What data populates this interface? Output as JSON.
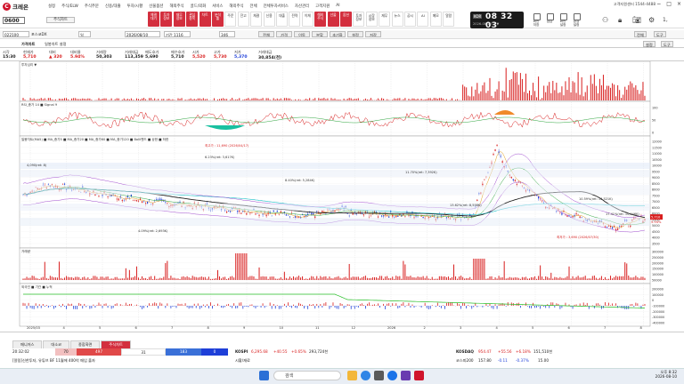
{
  "app": {
    "brand": "크레온",
    "brand_mark": "C"
  },
  "top_menu": [
    "설정",
    "주식/ELW",
    "주식주문",
    "신용/대출",
    "투자/시황",
    "선물옵션",
    "해외주식",
    "골드/외화",
    "서비스",
    "해외주식",
    "전체",
    "전체투자서비스",
    "자산관리",
    "고객지원",
    "AI"
  ],
  "help_line": "고객지원센터 1544-4488",
  "window_controls": [
    "−",
    "□",
    "×"
  ],
  "code_input": "0600",
  "account_select": "주식차트",
  "toolbar_buttons": [
    {
      "label": "체결\n대기"
    },
    {
      "label": "투자\n정보"
    },
    {
      "label": "재무\n정보"
    },
    {
      "label": "관심\n종목"
    },
    {
      "label": "차트"
    },
    {
      "label": "분석\n툴"
    },
    {
      "label": "주문"
    },
    {
      "label": "잔고"
    },
    {
      "label": "체결"
    },
    {
      "label": "신용"
    },
    {
      "label": "대출"
    },
    {
      "label": "전략"
    },
    {
      "label": "이체"
    },
    {
      "label": "해외\n주식"
    },
    {
      "label": "선물"
    },
    {
      "label": "옵션"
    },
    {
      "label": "투자\n정보"
    },
    {
      "label": "시장\n정보"
    },
    {
      "label": "재무"
    },
    {
      "label": "뉴스"
    },
    {
      "label": "공시"
    },
    {
      "label": "AI"
    },
    {
      "label": "메모"
    },
    {
      "label": "알람"
    }
  ],
  "clock": {
    "label": "KOR",
    "time": "08 32 03",
    "sub": "2026-08-10   주 ▼"
  },
  "right_tools": [
    "화면\n저장",
    "잠금",
    "화면\n설정",
    "환경\n설정"
  ],
  "row2": {
    "code": "022100",
    "name": "포스코DX",
    "period": "일",
    "date": "2026/08/10",
    "range": "기간 1116",
    "count": "346",
    "options": [
      "전체",
      "가격",
      "이동",
      "분할",
      "초기화",
      "설정",
      "저장"
    ],
    "right_buttons": [
      "전체",
      "도구"
    ]
  },
  "row3": {
    "title": "가격차트",
    "subtitle": "일봉차트 설정",
    "right_buttons": [
      "설정",
      "도구"
    ]
  },
  "quote": {
    "headers": [
      "시각",
      "현재가",
      "대비",
      "대비율",
      "거래량",
      "거래대금",
      "매도호가",
      "매수호가",
      "시가",
      "고가",
      "저가",
      "거래대금"
    ],
    "values": [
      "15:30",
      "5,710",
      "▲ 320",
      "5.94%",
      "50,303",
      "113,359",
      "5,690",
      "5,710",
      "5,520",
      "5,730",
      "5,370",
      "30,854(천)"
    ]
  },
  "chart_panels": {
    "p1_tag": "투자심리 ▼",
    "p2_tag": "RSI_종가 14 ■ Signal 9",
    "p3_tag": "일봉차트(MA5) ■ MA_종가5 ■ MA_종가20 ■ MA_종가60 ■ MA_종가120 ■ Bolli밴드 ■ 상한 ■ 하한",
    "p4_tag": "거래량",
    "p5_tag": "외국인 ■ 기관 ■ 누적",
    "annotations": [
      {
        "text": "최고가 : 11,690 (2026/04/17)"
      },
      {
        "text": "6.23%(ret: 3,617K)"
      },
      {
        "text": "11.70%(ret: 7,392K)"
      },
      {
        "text": "8.40%(ret: 5,284K)"
      },
      {
        "text": "10.59%(ret: 16,521K)"
      },
      {
        "text": "13.62%(ret: 8,558K)"
      },
      {
        "text": "4.09%(ret: 2,693K)"
      },
      {
        "text": "17.41%(ret: 10,946K)"
      },
      {
        "text": "최저가 : 3,690 (2026/07/30)"
      },
      {
        "text": "4,090(ret: 8)"
      }
    ],
    "price_axis": [
      "12000",
      "11500",
      "11000",
      "10500",
      "10000",
      "9500",
      "9000",
      "8500",
      "8000",
      "7500",
      "7000",
      "6500",
      "6000",
      "5500",
      "5000",
      "4500",
      "4000",
      "3500"
    ],
    "rsi_axis": [
      "100",
      "50",
      "0"
    ],
    "vol_axis": [
      "300000",
      "250000",
      "200000",
      "150000",
      "100000",
      "50000"
    ],
    "flow_axis": [
      "200000",
      "100000",
      "0",
      "-100000",
      "-200000",
      "-300000",
      "-400000"
    ],
    "x_labels": [
      "2025/03",
      "4",
      "5",
      "6",
      "7",
      "8",
      "9",
      "10",
      "11",
      "12",
      "2026",
      "2",
      "3",
      "4",
      "5",
      "6",
      "7",
      "8"
    ],
    "last_price_badge": "5,710",
    "last_pct_badge": "5.94%"
  },
  "bottom": {
    "tabs": [
      {
        "label": "매니저스",
        "active": false
      },
      {
        "label": "대소코",
        "active": false
      },
      {
        "label": "종합화면",
        "active": false
      },
      {
        "label": "주식차트",
        "active": true
      }
    ],
    "strip1": {
      "time": "20:32:02",
      "p1": "70",
      "p2": "497",
      "p3": "31",
      "p4": "183",
      "p5": "0",
      "kospi_label": "KOSPI",
      "kospi": "6,295.68",
      "kospi_chg": "+40.55",
      "kospi_pct": "+0.65%",
      "kospi_amt": "293,724천",
      "kosdaq_label": "KOSDAQ",
      "kosdaq": "954.47",
      "kosdaq_chg": "+55.56",
      "kosdaq_pct": "+6.18%",
      "kosdaq_amt": "151,510천"
    },
    "strip2": {
      "news": "[알림]신한투자, 유튜브 BF 11월에 400억 매입 출자",
      "market": "시황/재료",
      "kospi200_label": "코스피200",
      "kospi200": "157.80",
      "k2_chg": "-0.11",
      "k2_pct": "-0.37%",
      "k2_amt": "15.00"
    }
  },
  "taskbar": {
    "search_placeholder": "검색",
    "time": "오후 8:32",
    "date": "2026-08-10"
  },
  "colors": {
    "brand": "#d0142c",
    "up": "#d81e1e",
    "down": "#1e3fd8",
    "ma5": "#e0a020",
    "ma20": "#2aa43a",
    "ma60": "#8a2be2",
    "ma120": "#1ac0c8",
    "bollinger": "#a04ad0"
  }
}
